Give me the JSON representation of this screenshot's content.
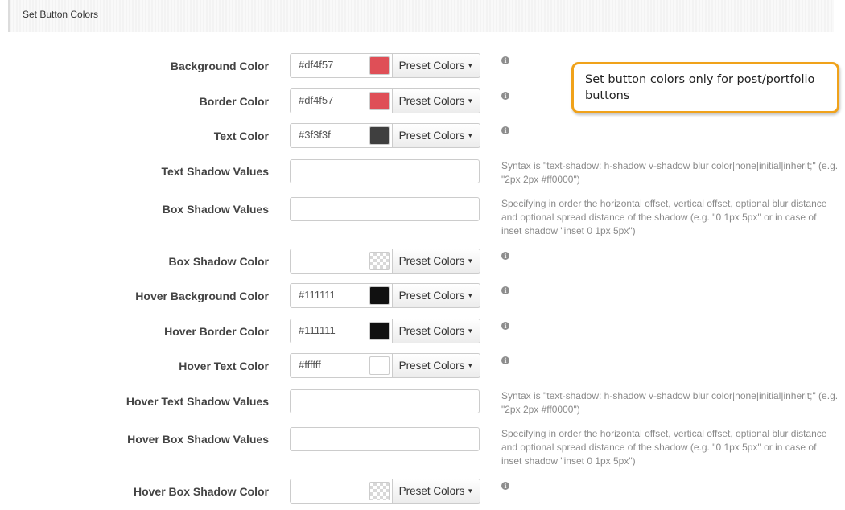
{
  "section": {
    "title": "Set Button Colors"
  },
  "preset_label": "Preset Colors",
  "icons": {
    "info": "info-icon",
    "caret": "caret-down-icon"
  },
  "callout": {
    "text": "Set button colors only for post/portfolio buttons",
    "border_color": "#f0a21a"
  },
  "fields": {
    "background_color": {
      "label": "Background Color",
      "value": "#df4f57",
      "swatch": "#df4f57"
    },
    "border_color": {
      "label": "Border Color",
      "value": "#df4f57",
      "swatch": "#df4f57"
    },
    "text_color": {
      "label": "Text Color",
      "value": "#3f3f3f",
      "swatch": "#3f3f3f"
    },
    "text_shadow": {
      "label": "Text Shadow Values",
      "value": "",
      "help": "Syntax is \"text-shadow: h-shadow v-shadow blur color|none|initial|inherit;\" (e.g. \"2px 2px #ff0000\")"
    },
    "box_shadow": {
      "label": "Box Shadow Values",
      "value": "",
      "help": "Specifying in order the horizontal offset, vertical offset, optional blur distance and optional spread distance of the shadow (e.g. \"0 1px 5px\" or in case of inset shadow \"inset 0 1px 5px\")"
    },
    "box_shadow_color": {
      "label": "Box Shadow Color",
      "value": "",
      "swatch": "transparent"
    },
    "hover_background_color": {
      "label": "Hover Background Color",
      "value": "#111111",
      "swatch": "#111111"
    },
    "hover_border_color": {
      "label": "Hover Border Color",
      "value": "#111111",
      "swatch": "#111111"
    },
    "hover_text_color": {
      "label": "Hover Text Color",
      "value": "#ffffff",
      "swatch": "#ffffff"
    },
    "hover_text_shadow": {
      "label": "Hover Text Shadow Values",
      "value": "",
      "help": "Syntax is \"text-shadow: h-shadow v-shadow blur color|none|initial|inherit;\" (e.g. \"2px 2px #ff0000\")"
    },
    "hover_box_shadow": {
      "label": "Hover Box Shadow Values",
      "value": "",
      "help": "Specifying in order the horizontal offset, vertical offset, optional blur distance and optional spread distance of the shadow (e.g. \"0 1px 5px\" or in case of inset shadow \"inset 0 1px 5px\")"
    },
    "hover_box_shadow_color": {
      "label": "Hover Box Shadow Color",
      "value": "",
      "swatch": "transparent"
    }
  }
}
